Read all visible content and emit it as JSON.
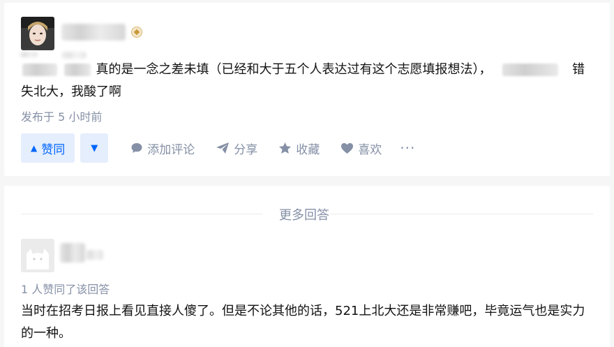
{
  "answer": {
    "text_start": "真的是一念之差未填（已经和大于五个人表达过有这个志愿填报想法），",
    "text_end": "错失北大，我酸了啊",
    "published": "发布于 5 小时前",
    "actions": {
      "upvote_label": "赞同",
      "comment_label": "添加评论",
      "share_label": "分享",
      "favorite_label": "收藏",
      "like_label": "喜欢",
      "more_label": "···"
    },
    "icons": {
      "upvote": "triangle-up-icon",
      "downvote": "triangle-down-icon",
      "comment": "comment-bubble-icon",
      "share": "paper-plane-icon",
      "favorite": "star-icon",
      "like": "heart-icon",
      "more": "ellipsis-icon",
      "badge": "badge-icon"
    }
  },
  "more_answers": {
    "divider_label": "更多回答",
    "answer": {
      "upvote_info": "1 人赞同了该回答",
      "text": "当时在招考日报上看见直接人傻了。但是不论其他的话，521上北大还是非常赚吧，毕竟运气也是实力的一种。"
    }
  },
  "colors": {
    "accent": "#0066ff",
    "accent_bg": "#e5eefc",
    "meta": "#8590a6",
    "text": "#121212",
    "page_bg": "#f6f6f6"
  }
}
